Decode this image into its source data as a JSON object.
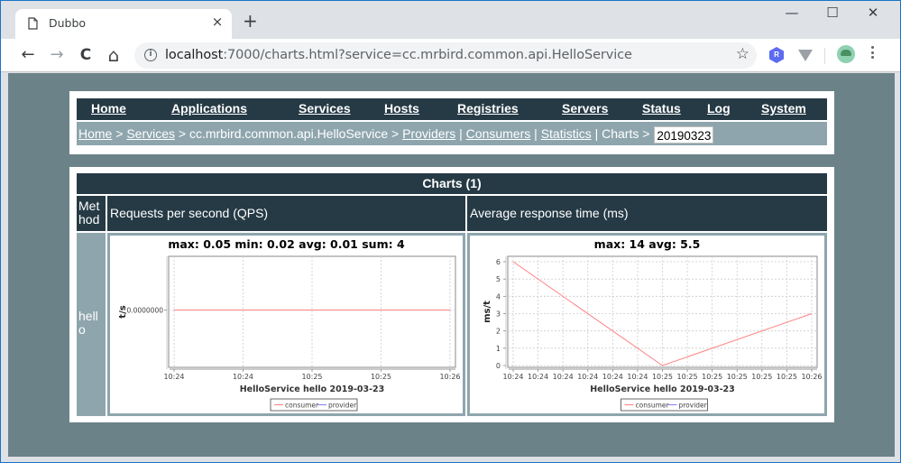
{
  "browser": {
    "tab_title": "Dubbo",
    "tab_close": "×",
    "new_tab": "+",
    "url_host": "localhost",
    "url_rest": ":7000/charts.html?service=cc.mrbird.common.api.HelloService",
    "window_controls": {
      "minimize": "—",
      "maximize": "☐",
      "close": "✕"
    },
    "nav": {
      "back": "←",
      "forward": "→",
      "reload": "C",
      "home": "⌂"
    },
    "star": "☆",
    "ext_r_label": "R",
    "info": "i"
  },
  "menu": {
    "items": [
      "Home",
      "Applications",
      "Services",
      "Hosts",
      "Registries",
      "Servers",
      "Status",
      "Log",
      "System"
    ]
  },
  "breadcrumb": {
    "home": "Home",
    "sep1": " > ",
    "services": "Services",
    "sep2": " > cc.mrbird.common.api.HelloService > ",
    "providers": "Providers",
    "pipe1": " | ",
    "consumers": "Consumers",
    "pipe2": " | ",
    "statistics": "Statistics",
    "tail": " | Charts > ",
    "date_value": "20190323"
  },
  "table": {
    "title": "Charts (1)",
    "headers": {
      "method": "Met hod",
      "qps": "Requests per second (QPS)",
      "rt": "Average response time (ms)"
    },
    "rows": [
      {
        "method": "hell o"
      }
    ]
  },
  "chart_data": [
    {
      "type": "line",
      "title": "max: 0.05 min: 0.02 avg: 0.01 sum: 4",
      "xlabel": "HelloService  hello  2019-03-23",
      "ylabel": "t/s",
      "x": [
        "10:24",
        "10:24",
        "10:25",
        "10:25",
        "10:26"
      ],
      "yticks": [
        "0.0000000"
      ],
      "ylim": [
        -1,
        1
      ],
      "grid": true,
      "legend": [
        "consumer",
        "provider"
      ],
      "legend_position": "bottom",
      "series": [
        {
          "name": "consumer",
          "color": "#ff8080",
          "values": [
            0,
            0,
            0,
            0,
            0
          ]
        },
        {
          "name": "provider",
          "color": "#8080ff",
          "values": []
        }
      ]
    },
    {
      "type": "line",
      "title": "max: 14 avg: 5.5",
      "xlabel": "HelloService  hello  2019-03-23",
      "ylabel": "ms/t",
      "x": [
        "10:24",
        "10:24",
        "10:24",
        "10:24",
        "10:24",
        "10:24",
        "10:25",
        "10:25",
        "10:25",
        "10:25",
        "10:25",
        "10:25",
        "10:26"
      ],
      "yticks": [
        0,
        1,
        2,
        3,
        4,
        5,
        6
      ],
      "ylim": [
        0,
        6
      ],
      "grid": true,
      "legend": [
        "consumer",
        "provider"
      ],
      "legend_position": "bottom",
      "series": [
        {
          "name": "consumer",
          "color": "#ff8080",
          "points": [
            [
              0,
              6
            ],
            [
              6,
              0
            ],
            [
              12,
              3
            ]
          ]
        },
        {
          "name": "provider",
          "color": "#8080ff",
          "points": []
        }
      ]
    }
  ],
  "colors": {
    "page_bg": "#6c8289",
    "menu_bg": "#253a45",
    "crumb_bg": "#8ea5ad",
    "consumer": "#ff8080",
    "provider": "#8080ff"
  }
}
